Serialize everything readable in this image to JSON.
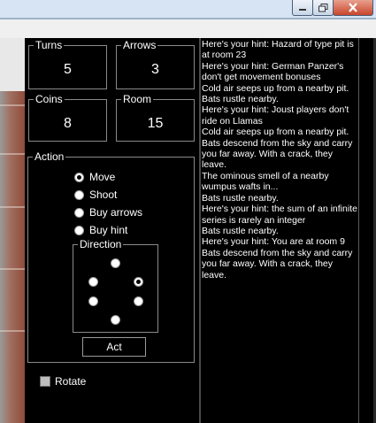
{
  "stats": {
    "turns": {
      "label": "Turns",
      "value": "5"
    },
    "arrows": {
      "label": "Arrows",
      "value": "3"
    },
    "coins": {
      "label": "Coins",
      "value": "8"
    },
    "room": {
      "label": "Room",
      "value": "15"
    }
  },
  "action": {
    "label": "Action",
    "options": [
      {
        "label": "Move",
        "selected": true
      },
      {
        "label": "Shoot",
        "selected": false
      },
      {
        "label": "Buy arrows",
        "selected": false
      },
      {
        "label": "Buy hint",
        "selected": false
      }
    ],
    "direction_label": "Direction",
    "direction_selected_index": 2,
    "act_label": "Act"
  },
  "rotate": {
    "label": "Rotate",
    "checked": false
  },
  "log": [
    "Here's your hint: Hazard of type pit is at room 23",
    "Here's your hint: German Panzer's don't get movement bonuses",
    "Cold air seeps up from a nearby pit.",
    "Bats rustle nearby.",
    "Here's your hint: Joust players don't ride on Llamas",
    "Cold air seeps up from a nearby pit.",
    "Bats descend from the sky and carry you far away. With a crack, they leave.",
    "The ominous smell of a nearby wumpus wafts in...",
    "Bats rustle nearby.",
    "Here's your hint: the sum of an infinite series is rarely an integer",
    "Bats rustle nearby.",
    "Here's your hint: You are at room 9",
    "Bats descend from the sky and carry you far away. With a crack, they leave."
  ]
}
